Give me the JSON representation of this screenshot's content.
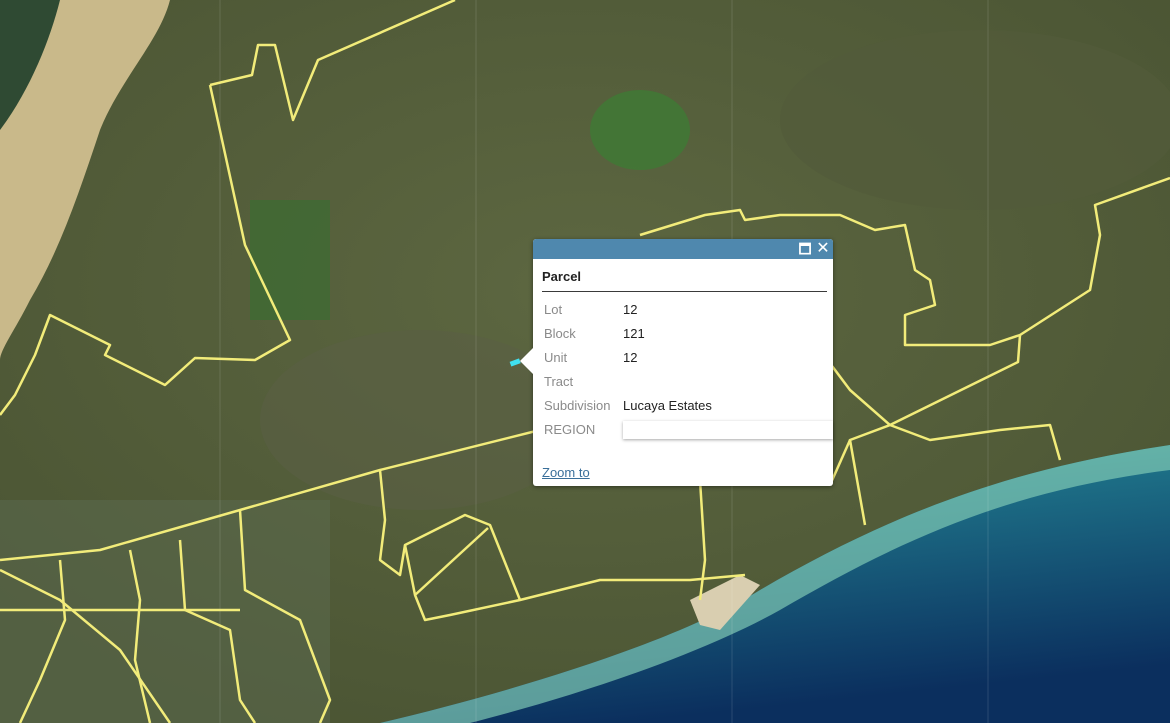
{
  "map": {
    "colors": {
      "boundary": "#f2ec7a",
      "land": "#58633d",
      "sea_shallow": "#3fa7a0",
      "sea_deep": "#0b2f5e",
      "sand": "#c9b98a",
      "selected_parcel": "#40e0f0"
    }
  },
  "popup": {
    "header_color": "#4f88ae",
    "maximize_icon": "maximize-icon",
    "close_icon": "close-icon",
    "maximize_glyph": "🗖",
    "close_glyph": "✕",
    "title": "Parcel",
    "fields": [
      {
        "name": "Lot",
        "value": "12"
      },
      {
        "name": "Block",
        "value": "121"
      },
      {
        "name": "Unit",
        "value": "12"
      },
      {
        "name": "Tract",
        "value": ""
      },
      {
        "name": "Subdivision",
        "value": "Lucaya Estates"
      }
    ],
    "region_label": "REGION",
    "zoom_label": "Zoom to"
  }
}
